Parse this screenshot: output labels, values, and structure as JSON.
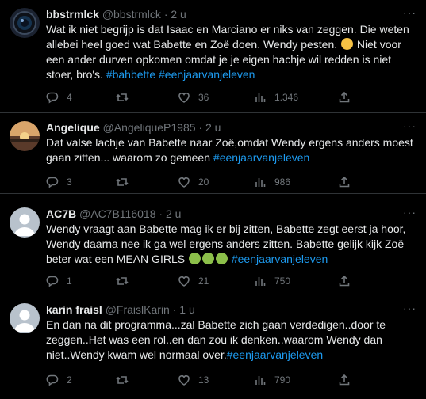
{
  "tweets": [
    {
      "name": "bbstrmlck",
      "handle": "@bbstrmlck",
      "time": "2 u",
      "text_before": "Wat ik niet begrijp is dat Isaac en Marciano er niks van zeggen. Die weten allebei heel goed wat Babette en Zoë doen. Wendy pesten.",
      "text_after": "Niet voor een ander durven opkomen omdat je je eigen hachje wil redden is niet stoer, bro's.",
      "hashtags": "#bahbette #eenjaarvanjeleven",
      "replies": "4",
      "retweets": "",
      "likes": "36",
      "views": "1.346"
    },
    {
      "name": "Angelique",
      "handle": "@AngeliqueP1985",
      "time": "2 u",
      "text": "Dat valse lachje van Babette naar Zoë,omdat Wendy ergens anders moest gaan zitten... waarom zo gemeen",
      "hashtags": "#eenjaarvanjeleven",
      "replies": "3",
      "retweets": "",
      "likes": "20",
      "views": "986"
    },
    {
      "name": "AC7B",
      "handle": "@AC7B116018",
      "time": "2 u",
      "text": "Wendy vraagt aan Babette mag ik er bij zitten, Babette zegt eerst ja hoor, Wendy daarna nee ik ga wel ergens anders zitten. Babette gelijk kijk Zoë beter wat een MEAN GIRLS",
      "hashtags": "#eenjaarvanjeleven",
      "replies": "1",
      "retweets": "",
      "likes": "21",
      "views": "750"
    },
    {
      "name": "karin fraisl",
      "handle": "@FraislKarin",
      "time": "1 u",
      "text": "En dan na dit programma...zal Babette zich gaan verdedigen..door te zeggen..Het was een rol..en dan zou ik denken..waarom Wendy dan niet..Wendy kwam wel normaal over.",
      "hashtags": "#eenjaarvanjeleven",
      "replies": "2",
      "retweets": "",
      "likes": "13",
      "views": "790"
    }
  ],
  "ui": {
    "dot": "·",
    "more": "···"
  },
  "colors": {
    "background": "#000000",
    "text": "#e7e9ea",
    "muted": "#71767b",
    "link": "#1d9bf0",
    "divider": "#2f3336"
  }
}
